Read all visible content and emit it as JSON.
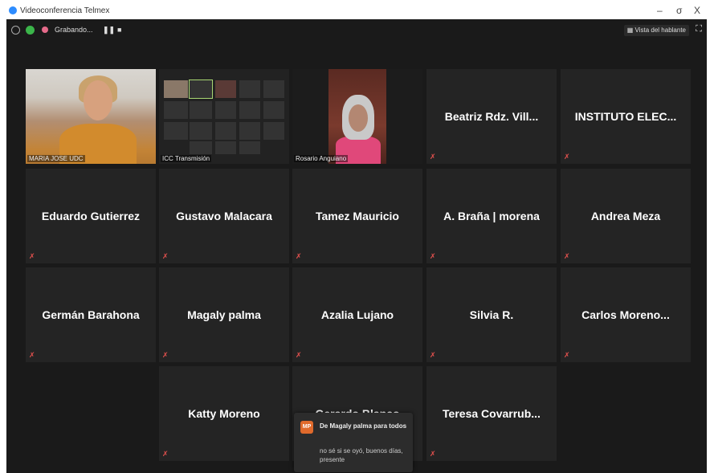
{
  "window": {
    "title": "Videoconferencia Telmex",
    "controls": {
      "minimize": "–",
      "maximize": "σ",
      "close": "X"
    }
  },
  "topbar": {
    "recording_label": "Grabando...",
    "pause_symbol": "❚❚",
    "stop_symbol": "■",
    "speaker_view_label": "Vista del hablante",
    "fullscreen_symbol": "⛶"
  },
  "participants": [
    {
      "name": "MARIA JOSE UDC",
      "video": true
    },
    {
      "name": "ICC Transmisión",
      "video": true,
      "active": true
    },
    {
      "name": "Rosario Anguiano",
      "video": true
    },
    {
      "name": "Beatriz Rdz. Vill..."
    },
    {
      "name": "INSTITUTO  ELEC..."
    },
    {
      "name": "Eduardo Gutierrez"
    },
    {
      "name": "Gustavo Malacara"
    },
    {
      "name": "Tamez Mauricio"
    },
    {
      "name": "A. Braña | morena"
    },
    {
      "name": "Andrea Meza"
    },
    {
      "name": "Germán Barahona"
    },
    {
      "name": "Magaly palma"
    },
    {
      "name": "Azalia Lujano"
    },
    {
      "name": "Silvia R."
    },
    {
      "name": "Carlos  Moreno..."
    },
    {
      "name": "Katty Moreno"
    },
    {
      "name": "Gerardo Blanco"
    },
    {
      "name": "Teresa  Covarrub..."
    }
  ],
  "chat": {
    "avatar_initials": "MP",
    "from": "De Magaly palma para todos",
    "message": "no sé si se oyó, buenos días, presente"
  },
  "colors": {
    "background": "#1a1a1a",
    "tile": "#242424",
    "active_speaker_border": "#a8d672",
    "muted_icon": "#e0504d"
  },
  "icons": [
    "info-icon",
    "shield-icon",
    "recording-icon",
    "pause-icon",
    "stop-icon",
    "speaker-view-icon",
    "fullscreen-icon",
    "muted-mic-icon"
  ]
}
